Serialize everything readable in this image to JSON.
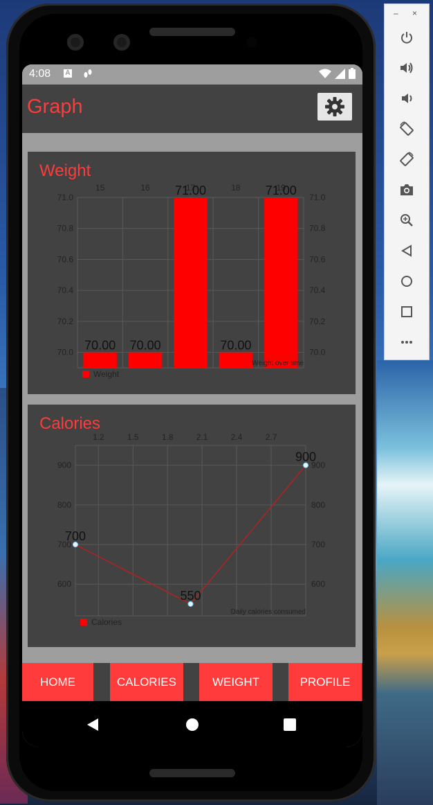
{
  "status_bar": {
    "time": "4:08",
    "sim_icon_label": "A",
    "left_icon": "walk-icon",
    "right_icons": [
      "wifi-icon",
      "signal-icon",
      "battery-icon"
    ]
  },
  "app_bar": {
    "title": "Graph",
    "settings_icon": "gear-icon"
  },
  "colors": {
    "accent": "#ff3b3b",
    "surface": "#424242",
    "background": "#9e9e9e",
    "bar_color": "#ff0000",
    "line_color": "#b22222",
    "point_color": "#e6f7ff"
  },
  "weight_card": {
    "title": "Weight",
    "legend": "Weight",
    "description": "Weight over time"
  },
  "calories_card": {
    "title": "Calories",
    "legend": "Calories",
    "description": "Daily calories consumed"
  },
  "chart_data": [
    {
      "type": "bar",
      "title": "Weight",
      "categories": [
        "15",
        "16",
        "17",
        "18",
        "19"
      ],
      "series": [
        {
          "name": "Weight",
          "values": [
            70.0,
            70.0,
            71.0,
            70.0,
            71.0
          ]
        }
      ],
      "value_labels": [
        "70.00",
        "70.00",
        "71.00",
        "70.00",
        "71.00"
      ],
      "ylim": [
        69.9,
        71.0
      ],
      "y_ticks": [
        "70.0",
        "70.2",
        "70.4",
        "70.6",
        "70.8",
        "71.0"
      ],
      "grid": true,
      "legend_position": "bottom-left",
      "description": "Weight over time"
    },
    {
      "type": "line",
      "title": "Calories",
      "x_ticks": [
        "1.2",
        "1.5",
        "1.8",
        "2.1",
        "2.4",
        "2.7"
      ],
      "series": [
        {
          "name": "Calories",
          "x": [
            1,
            2,
            3
          ],
          "y": [
            700,
            550,
            900
          ]
        }
      ],
      "value_labels": [
        "700",
        "550",
        "900"
      ],
      "xlim": [
        1.0,
        3.0
      ],
      "ylim": [
        520,
        950
      ],
      "y_ticks": [
        "600",
        "700",
        "800",
        "900"
      ],
      "grid": true,
      "legend_position": "bottom-left",
      "description": "Daily calories consumed"
    }
  ],
  "bottom_nav": {
    "home": "HOME",
    "calories": "CALORIES",
    "weight": "WEIGHT",
    "profile": "PROFILE"
  },
  "system_nav": {
    "back": "back-triangle-icon",
    "home": "home-circle-icon",
    "recents": "recents-square-icon"
  },
  "emulator_panel": {
    "minimize": "–",
    "close": "×",
    "buttons": [
      "power-icon",
      "volume-up-icon",
      "volume-down-icon",
      "rotate-left-icon",
      "rotate-right-icon",
      "camera-icon",
      "zoom-icon",
      "back-icon",
      "home-icon",
      "overview-icon",
      "more-icon"
    ]
  }
}
